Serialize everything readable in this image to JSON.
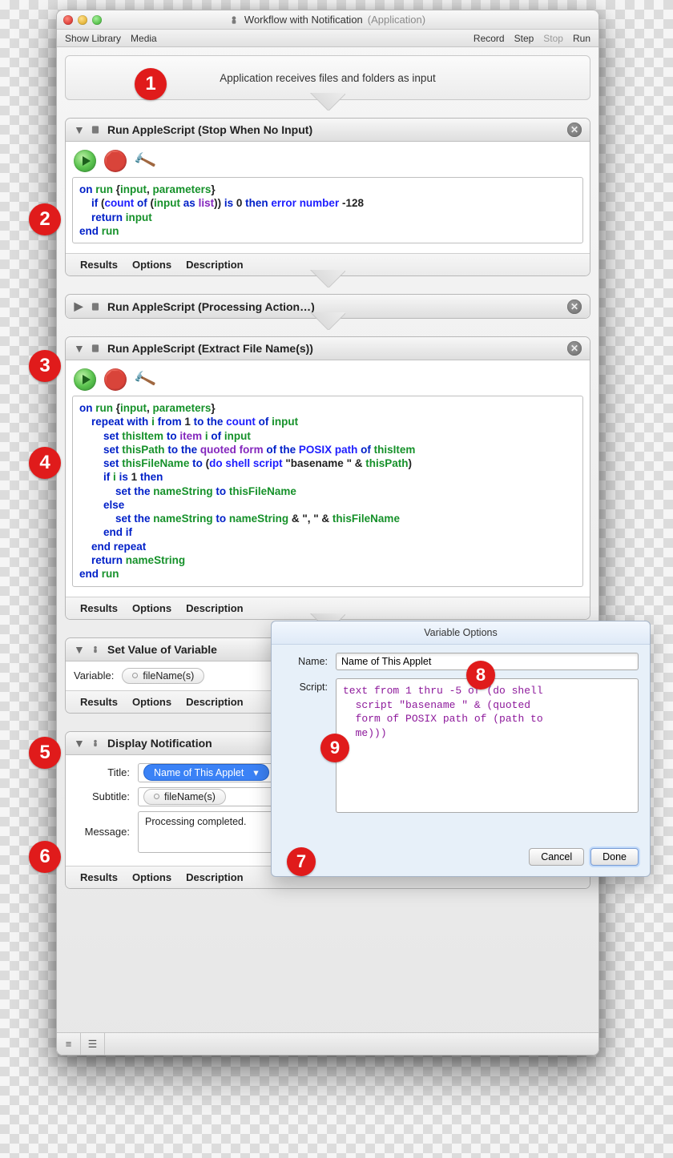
{
  "window": {
    "title": "Workflow with Notification",
    "app_type": "(Application)"
  },
  "toolbar": {
    "show_library": "Show Library",
    "media": "Media",
    "record": "Record",
    "step": "Step",
    "stop": "Stop",
    "run": "Run"
  },
  "input_desc": "Application receives files and folders as input",
  "actions": {
    "a1": {
      "title": "Run AppleScript (Stop When No Input)",
      "script_raw": "on run {input, parameters}\n    if (count of (input as list)) is 0 then error number -128\n    return input\nend run"
    },
    "a2": {
      "title": "Run AppleScript (Processing Action…)"
    },
    "a3": {
      "title": "Run AppleScript (Extract File Name(s))",
      "script_raw": "on run {input, parameters}\n    repeat with i from 1 to the count of input\n        set thisItem to item i of input\n        set thisPath to the quoted form of the POSIX path of thisItem\n        set thisFileName to (do shell script \"basename \" & thisPath)\n        if i is 1 then\n            set the nameString to thisFileName\n        else\n            set the nameString to nameString & \", \" & thisFileName\n        end if\n    end repeat\n    return nameString\nend run"
    },
    "a4": {
      "title": "Set Value of Variable",
      "variable_label": "Variable:",
      "variable_value": "fileName(s)"
    },
    "a5": {
      "title": "Display Notification",
      "title_label": "Title:",
      "title_value": "Name of This Applet",
      "subtitle_label": "Subtitle:",
      "subtitle_value": "fileName(s)",
      "message_label": "Message:",
      "message_value": "Processing completed."
    }
  },
  "tabs": {
    "results": "Results",
    "options": "Options",
    "description": "Description"
  },
  "popover": {
    "title": "Variable Options",
    "name_label": "Name:",
    "name_value": "Name of This Applet",
    "script_label": "Script:",
    "script_value": "text from 1 thru -5 of (do shell\n  script \"basename \" & (quoted\n  form of POSIX path of (path to\n  me)))",
    "cancel": "Cancel",
    "done": "Done"
  },
  "callouts": {
    "1": "1",
    "2": "2",
    "3": "3",
    "4": "4",
    "5": "5",
    "6": "6",
    "7": "7",
    "8": "8",
    "9": "9"
  }
}
